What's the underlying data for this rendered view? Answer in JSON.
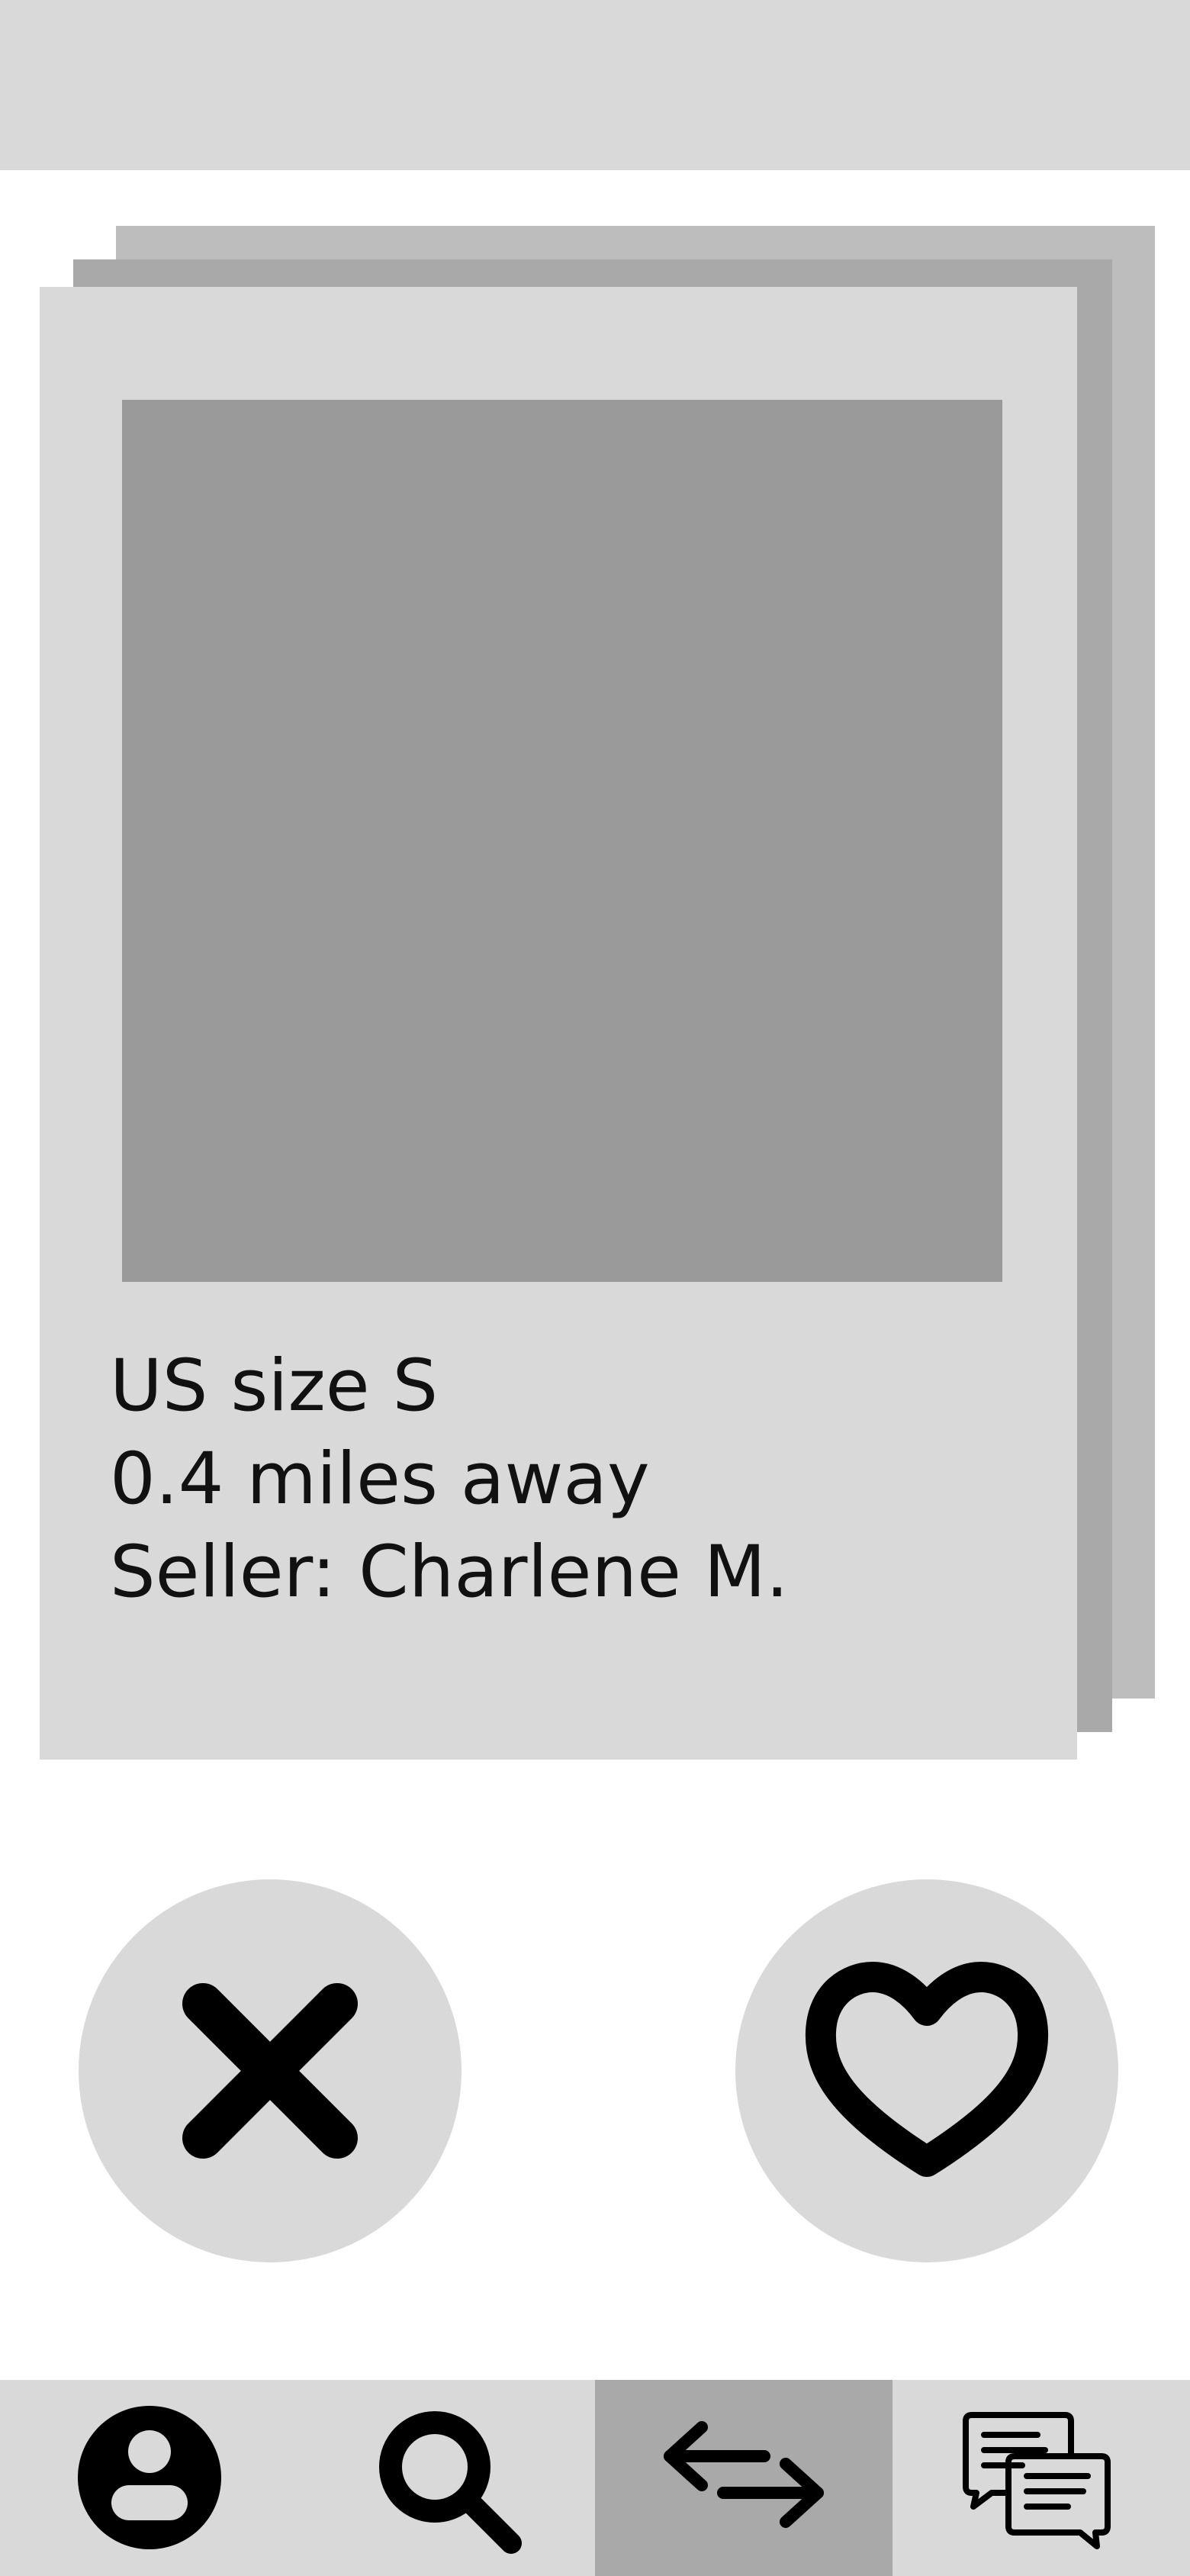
{
  "header": {},
  "listing": {
    "size": "US size S",
    "distance": "0.4 miles away",
    "seller": "Seller: Charlene M."
  },
  "actions": [
    {
      "name": "dislike",
      "icon": "close-icon"
    },
    {
      "name": "like",
      "icon": "heart-icon"
    }
  ],
  "nav": {
    "items": [
      {
        "name": "profile",
        "icon": "profile-icon",
        "active": false
      },
      {
        "name": "search",
        "icon": "search-icon",
        "active": false
      },
      {
        "name": "swap",
        "icon": "swap-arrows-icon",
        "active": true
      },
      {
        "name": "messages",
        "icon": "chat-bubbles-icon",
        "active": false
      }
    ]
  },
  "colors": {
    "panel": "#d9d9d9",
    "photo": "#9a9a9a",
    "active_nav": "#a9a9a9",
    "stack_back": "#bdbdbd"
  }
}
